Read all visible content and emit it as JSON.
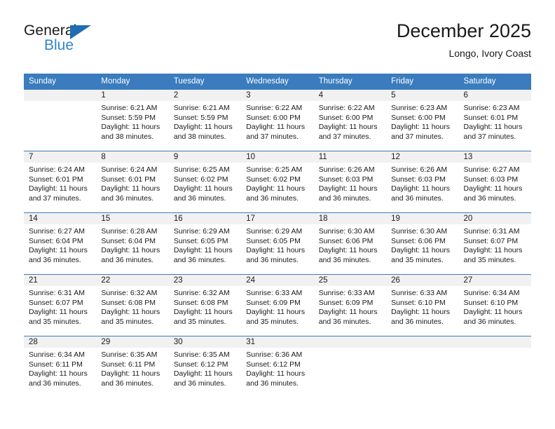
{
  "brand": {
    "name_top": "General",
    "name_bottom": "Blue",
    "triangle_color": "#1f6fb2",
    "blue_text_color": "#2f86cf"
  },
  "header": {
    "title": "December 2025",
    "subtitle": "Longo, Ivory Coast"
  },
  "theme": {
    "header_bg": "#3a7cbe",
    "header_text": "#ffffff",
    "daynum_band_bg": "#f1f1f1",
    "row_separator": "#3a7cbe",
    "page_bg": "#ffffff"
  },
  "weekday_headers": [
    "Sunday",
    "Monday",
    "Tuesday",
    "Wednesday",
    "Thursday",
    "Friday",
    "Saturday"
  ],
  "weeks": [
    [
      {
        "day": "",
        "sunrise": "",
        "sunset": "",
        "daylight_line1": "",
        "daylight_line2": ""
      },
      {
        "day": "1",
        "sunrise": "Sunrise: 6:21 AM",
        "sunset": "Sunset: 5:59 PM",
        "daylight_line1": "Daylight: 11 hours",
        "daylight_line2": "and 38 minutes."
      },
      {
        "day": "2",
        "sunrise": "Sunrise: 6:21 AM",
        "sunset": "Sunset: 5:59 PM",
        "daylight_line1": "Daylight: 11 hours",
        "daylight_line2": "and 38 minutes."
      },
      {
        "day": "3",
        "sunrise": "Sunrise: 6:22 AM",
        "sunset": "Sunset: 6:00 PM",
        "daylight_line1": "Daylight: 11 hours",
        "daylight_line2": "and 37 minutes."
      },
      {
        "day": "4",
        "sunrise": "Sunrise: 6:22 AM",
        "sunset": "Sunset: 6:00 PM",
        "daylight_line1": "Daylight: 11 hours",
        "daylight_line2": "and 37 minutes."
      },
      {
        "day": "5",
        "sunrise": "Sunrise: 6:23 AM",
        "sunset": "Sunset: 6:00 PM",
        "daylight_line1": "Daylight: 11 hours",
        "daylight_line2": "and 37 minutes."
      },
      {
        "day": "6",
        "sunrise": "Sunrise: 6:23 AM",
        "sunset": "Sunset: 6:01 PM",
        "daylight_line1": "Daylight: 11 hours",
        "daylight_line2": "and 37 minutes."
      }
    ],
    [
      {
        "day": "7",
        "sunrise": "Sunrise: 6:24 AM",
        "sunset": "Sunset: 6:01 PM",
        "daylight_line1": "Daylight: 11 hours",
        "daylight_line2": "and 37 minutes."
      },
      {
        "day": "8",
        "sunrise": "Sunrise: 6:24 AM",
        "sunset": "Sunset: 6:01 PM",
        "daylight_line1": "Daylight: 11 hours",
        "daylight_line2": "and 36 minutes."
      },
      {
        "day": "9",
        "sunrise": "Sunrise: 6:25 AM",
        "sunset": "Sunset: 6:02 PM",
        "daylight_line1": "Daylight: 11 hours",
        "daylight_line2": "and 36 minutes."
      },
      {
        "day": "10",
        "sunrise": "Sunrise: 6:25 AM",
        "sunset": "Sunset: 6:02 PM",
        "daylight_line1": "Daylight: 11 hours",
        "daylight_line2": "and 36 minutes."
      },
      {
        "day": "11",
        "sunrise": "Sunrise: 6:26 AM",
        "sunset": "Sunset: 6:03 PM",
        "daylight_line1": "Daylight: 11 hours",
        "daylight_line2": "and 36 minutes."
      },
      {
        "day": "12",
        "sunrise": "Sunrise: 6:26 AM",
        "sunset": "Sunset: 6:03 PM",
        "daylight_line1": "Daylight: 11 hours",
        "daylight_line2": "and 36 minutes."
      },
      {
        "day": "13",
        "sunrise": "Sunrise: 6:27 AM",
        "sunset": "Sunset: 6:03 PM",
        "daylight_line1": "Daylight: 11 hours",
        "daylight_line2": "and 36 minutes."
      }
    ],
    [
      {
        "day": "14",
        "sunrise": "Sunrise: 6:27 AM",
        "sunset": "Sunset: 6:04 PM",
        "daylight_line1": "Daylight: 11 hours",
        "daylight_line2": "and 36 minutes."
      },
      {
        "day": "15",
        "sunrise": "Sunrise: 6:28 AM",
        "sunset": "Sunset: 6:04 PM",
        "daylight_line1": "Daylight: 11 hours",
        "daylight_line2": "and 36 minutes."
      },
      {
        "day": "16",
        "sunrise": "Sunrise: 6:29 AM",
        "sunset": "Sunset: 6:05 PM",
        "daylight_line1": "Daylight: 11 hours",
        "daylight_line2": "and 36 minutes."
      },
      {
        "day": "17",
        "sunrise": "Sunrise: 6:29 AM",
        "sunset": "Sunset: 6:05 PM",
        "daylight_line1": "Daylight: 11 hours",
        "daylight_line2": "and 36 minutes."
      },
      {
        "day": "18",
        "sunrise": "Sunrise: 6:30 AM",
        "sunset": "Sunset: 6:06 PM",
        "daylight_line1": "Daylight: 11 hours",
        "daylight_line2": "and 36 minutes."
      },
      {
        "day": "19",
        "sunrise": "Sunrise: 6:30 AM",
        "sunset": "Sunset: 6:06 PM",
        "daylight_line1": "Daylight: 11 hours",
        "daylight_line2": "and 35 minutes."
      },
      {
        "day": "20",
        "sunrise": "Sunrise: 6:31 AM",
        "sunset": "Sunset: 6:07 PM",
        "daylight_line1": "Daylight: 11 hours",
        "daylight_line2": "and 35 minutes."
      }
    ],
    [
      {
        "day": "21",
        "sunrise": "Sunrise: 6:31 AM",
        "sunset": "Sunset: 6:07 PM",
        "daylight_line1": "Daylight: 11 hours",
        "daylight_line2": "and 35 minutes."
      },
      {
        "day": "22",
        "sunrise": "Sunrise: 6:32 AM",
        "sunset": "Sunset: 6:08 PM",
        "daylight_line1": "Daylight: 11 hours",
        "daylight_line2": "and 35 minutes."
      },
      {
        "day": "23",
        "sunrise": "Sunrise: 6:32 AM",
        "sunset": "Sunset: 6:08 PM",
        "daylight_line1": "Daylight: 11 hours",
        "daylight_line2": "and 35 minutes."
      },
      {
        "day": "24",
        "sunrise": "Sunrise: 6:33 AM",
        "sunset": "Sunset: 6:09 PM",
        "daylight_line1": "Daylight: 11 hours",
        "daylight_line2": "and 35 minutes."
      },
      {
        "day": "25",
        "sunrise": "Sunrise: 6:33 AM",
        "sunset": "Sunset: 6:09 PM",
        "daylight_line1": "Daylight: 11 hours",
        "daylight_line2": "and 36 minutes."
      },
      {
        "day": "26",
        "sunrise": "Sunrise: 6:33 AM",
        "sunset": "Sunset: 6:10 PM",
        "daylight_line1": "Daylight: 11 hours",
        "daylight_line2": "and 36 minutes."
      },
      {
        "day": "27",
        "sunrise": "Sunrise: 6:34 AM",
        "sunset": "Sunset: 6:10 PM",
        "daylight_line1": "Daylight: 11 hours",
        "daylight_line2": "and 36 minutes."
      }
    ],
    [
      {
        "day": "28",
        "sunrise": "Sunrise: 6:34 AM",
        "sunset": "Sunset: 6:11 PM",
        "daylight_line1": "Daylight: 11 hours",
        "daylight_line2": "and 36 minutes."
      },
      {
        "day": "29",
        "sunrise": "Sunrise: 6:35 AM",
        "sunset": "Sunset: 6:11 PM",
        "daylight_line1": "Daylight: 11 hours",
        "daylight_line2": "and 36 minutes."
      },
      {
        "day": "30",
        "sunrise": "Sunrise: 6:35 AM",
        "sunset": "Sunset: 6:12 PM",
        "daylight_line1": "Daylight: 11 hours",
        "daylight_line2": "and 36 minutes."
      },
      {
        "day": "31",
        "sunrise": "Sunrise: 6:36 AM",
        "sunset": "Sunset: 6:12 PM",
        "daylight_line1": "Daylight: 11 hours",
        "daylight_line2": "and 36 minutes."
      },
      {
        "day": "",
        "sunrise": "",
        "sunset": "",
        "daylight_line1": "",
        "daylight_line2": ""
      },
      {
        "day": "",
        "sunrise": "",
        "sunset": "",
        "daylight_line1": "",
        "daylight_line2": ""
      },
      {
        "day": "",
        "sunrise": "",
        "sunset": "",
        "daylight_line1": "",
        "daylight_line2": ""
      }
    ]
  ]
}
